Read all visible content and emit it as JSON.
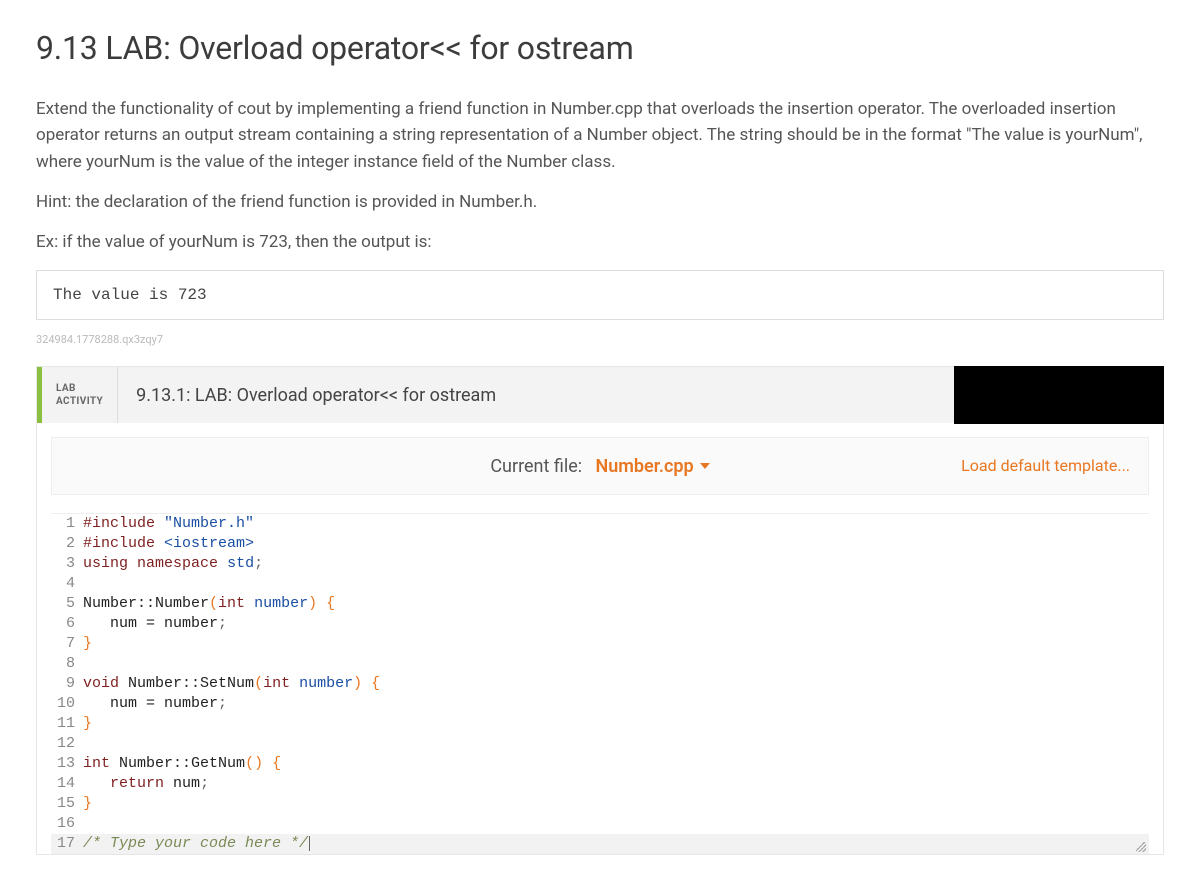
{
  "title": "9.13 LAB: Overload operator<< for ostream",
  "paragraphs": {
    "p1": "Extend the functionality of cout by implementing a friend function in Number.cpp that overloads the insertion operator. The overloaded insertion operator returns an output stream containing a string representation of a Number object. The string should be in the format \"The value is yourNum\", where yourNum is the value of the integer instance field of the Number class.",
    "p2": "Hint: the declaration of the friend function is provided in Number.h.",
    "p3": "Ex: if the value of yourNum is 723, then the output is:"
  },
  "example_output": "The value is 723",
  "seed": "324984.1778288.qx3zqy7",
  "activity": {
    "kind_line1": "LAB",
    "kind_line2": "ACTIVITY",
    "title": "9.13.1: LAB: Overload operator<< for ostream"
  },
  "filebar": {
    "label": "Current file:",
    "filename": "Number.cpp",
    "load_default": "Load default template..."
  },
  "code_lines": [
    {
      "n": "1",
      "tokens": [
        [
          "pp",
          "#include"
        ],
        [
          "",
          " "
        ],
        [
          "str",
          "\"Number.h\""
        ]
      ]
    },
    {
      "n": "2",
      "tokens": [
        [
          "pp",
          "#include"
        ],
        [
          "",
          " "
        ],
        [
          "str",
          "<iostream>"
        ]
      ]
    },
    {
      "n": "3",
      "tokens": [
        [
          "kw",
          "using"
        ],
        [
          "",
          " "
        ],
        [
          "kw",
          "namespace"
        ],
        [
          "",
          " "
        ],
        [
          "type",
          "std"
        ],
        [
          "punc",
          ";"
        ]
      ]
    },
    {
      "n": "4",
      "tokens": []
    },
    {
      "n": "5",
      "tokens": [
        [
          "id",
          "Number::Number"
        ],
        [
          "brace",
          "("
        ],
        [
          "kw",
          "int"
        ],
        [
          "",
          " "
        ],
        [
          "type",
          "number"
        ],
        [
          "brace",
          ")"
        ],
        [
          "",
          " "
        ],
        [
          "brace",
          "{"
        ]
      ]
    },
    {
      "n": "6",
      "tokens": [
        [
          "",
          "   "
        ],
        [
          "id",
          "num = number"
        ],
        [
          "punc",
          ";"
        ]
      ]
    },
    {
      "n": "7",
      "tokens": [
        [
          "brace",
          "}"
        ]
      ]
    },
    {
      "n": "8",
      "tokens": []
    },
    {
      "n": "9",
      "tokens": [
        [
          "kw",
          "void"
        ],
        [
          "",
          " "
        ],
        [
          "id",
          "Number::SetNum"
        ],
        [
          "brace",
          "("
        ],
        [
          "kw",
          "int"
        ],
        [
          "",
          " "
        ],
        [
          "type",
          "number"
        ],
        [
          "brace",
          ")"
        ],
        [
          "",
          " "
        ],
        [
          "brace",
          "{"
        ]
      ]
    },
    {
      "n": "10",
      "tokens": [
        [
          "",
          "   "
        ],
        [
          "id",
          "num = number"
        ],
        [
          "punc",
          ";"
        ]
      ]
    },
    {
      "n": "11",
      "tokens": [
        [
          "brace",
          "}"
        ]
      ]
    },
    {
      "n": "12",
      "tokens": []
    },
    {
      "n": "13",
      "tokens": [
        [
          "kw",
          "int"
        ],
        [
          "",
          " "
        ],
        [
          "id",
          "Number::GetNum"
        ],
        [
          "brace",
          "("
        ],
        [
          "brace",
          ")"
        ],
        [
          "",
          " "
        ],
        [
          "brace",
          "{"
        ]
      ]
    },
    {
      "n": "14",
      "tokens": [
        [
          "",
          "   "
        ],
        [
          "kw",
          "return"
        ],
        [
          "",
          " "
        ],
        [
          "id",
          "num"
        ],
        [
          "punc",
          ";"
        ]
      ]
    },
    {
      "n": "15",
      "tokens": [
        [
          "brace",
          "}"
        ]
      ]
    },
    {
      "n": "16",
      "tokens": []
    },
    {
      "n": "17",
      "tokens": [
        [
          "cmt",
          "/* Type your code here */"
        ]
      ],
      "highlight": true,
      "cursor": true
    }
  ]
}
